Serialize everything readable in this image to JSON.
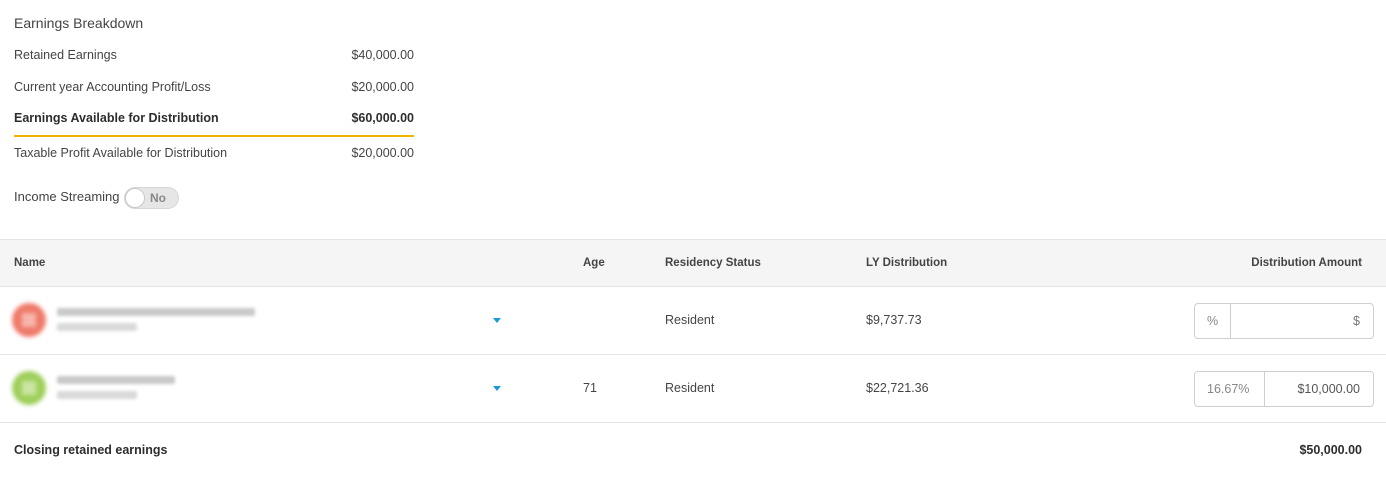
{
  "breakdown": {
    "title": "Earnings Breakdown",
    "rows": [
      {
        "label": "Retained Earnings",
        "value": "$40,000.00"
      },
      {
        "label": "Current year Accounting Profit/Loss",
        "value": "$20,000.00"
      },
      {
        "label": "Earnings Available for Distribution",
        "value": "$60,000.00"
      },
      {
        "label": "Taxable Profit Available for Distribution",
        "value": "$20,000.00"
      }
    ],
    "accent_color": "#f0b400"
  },
  "income_streaming": {
    "label": "Income Streaming",
    "toggle_state": "No",
    "enabled": false
  },
  "table": {
    "headers": {
      "name": "Name",
      "age": "Age",
      "residency": "Residency Status",
      "ly_distribution": "LY Distribution",
      "distribution_amount": "Distribution Amount"
    },
    "rows": [
      {
        "age": "",
        "residency": "Resident",
        "ly_distribution": "$9,737.73",
        "percent_placeholder": "%",
        "amount_placeholder": "$",
        "percent_value": "",
        "amount_value": "",
        "avatar_color": "#ef7a6a"
      },
      {
        "age": "71",
        "residency": "Resident",
        "ly_distribution": "$22,721.36",
        "percent_placeholder": "%",
        "amount_placeholder": "$",
        "percent_value": "16.67%",
        "amount_value": "$10,000.00",
        "avatar_color": "#9fcf5a"
      }
    ],
    "dropdown_color": "#1a9bd7"
  },
  "closing": {
    "label": "Closing retained earnings",
    "value": "$50,000.00"
  }
}
